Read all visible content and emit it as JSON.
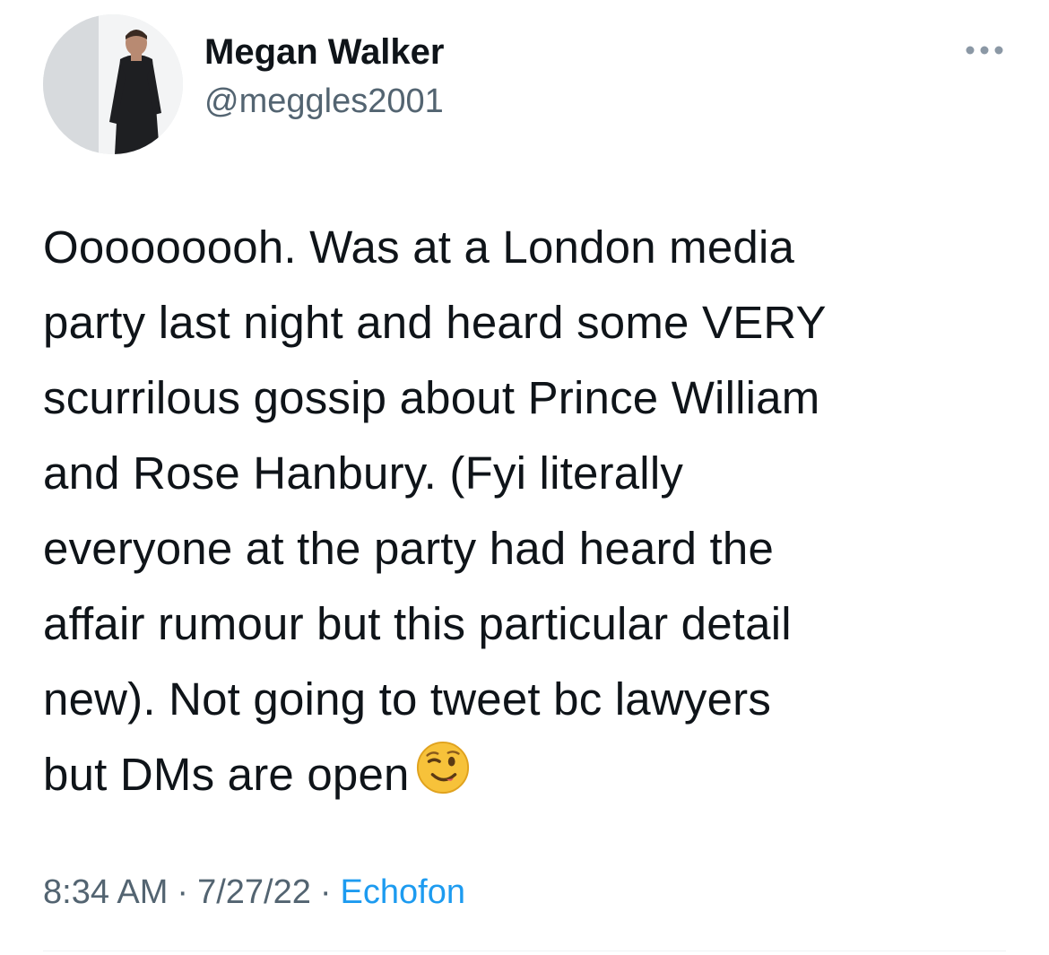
{
  "author": {
    "display_name": "Megan Walker",
    "handle": "@meggles2001"
  },
  "tweet": {
    "text": "Ooooooooh. Was at a London media party last night and heard some VERY scurrilous gossip about Prince William and Rose Hanbury. (Fyi literally everyone at the party had heard the affair rumour but this particular detail new). Not going to tweet bc lawyers but DMs are open",
    "text_lines": [
      "Ooooooooh. Was at a London media",
      "party last night and heard some VERY",
      "scurrilous gossip about Prince William",
      "and Rose Hanbury. (Fyi literally",
      "everyone at the party had heard the",
      "affair rumour but this particular detail",
      "new). Not going to tweet bc lawyers",
      "but DMs are open"
    ],
    "emoji": "winking-face"
  },
  "meta": {
    "time": "8:34 AM",
    "separator": "·",
    "date": "7/27/22",
    "source": "Echofon"
  },
  "icons": {
    "more": "more-horizontal-icon",
    "avatar": "profile-photo"
  },
  "colors": {
    "text": "#0f1419",
    "secondary": "#536471",
    "link": "#1d9bf0",
    "divider": "#eff3f4"
  }
}
